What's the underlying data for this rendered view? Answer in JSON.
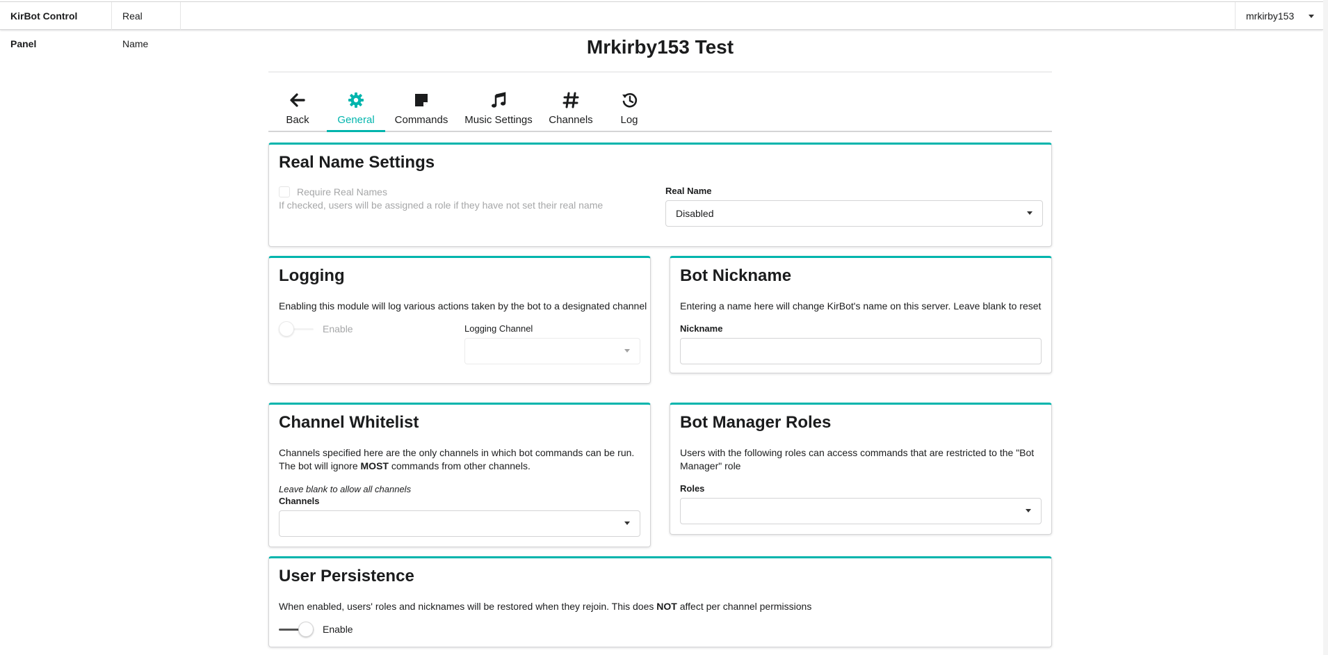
{
  "topbar": {
    "brand": "KirBot Control Panel",
    "section": "Real Name",
    "user": "mrkirby153"
  },
  "page": {
    "title": "Mrkirby153 Test"
  },
  "tabs": [
    {
      "label": "Back",
      "icon": "arrow-left-icon"
    },
    {
      "label": "General",
      "icon": "gear-icon",
      "active": true
    },
    {
      "label": "Commands",
      "icon": "sticky-note-icon"
    },
    {
      "label": "Music Settings",
      "icon": "music-icon"
    },
    {
      "label": "Channels",
      "icon": "hashtag-icon"
    },
    {
      "label": "Log",
      "icon": "history-icon"
    }
  ],
  "realname": {
    "title": "Real Name Settings",
    "checkbox_label": "Require Real Names",
    "checkbox_desc": "If checked, users will be assigned a role if they have not set their real name",
    "select_label": "Real Name",
    "select_value": "Disabled"
  },
  "logging": {
    "title": "Logging",
    "desc": "Enabling this module will log various actions taken by the bot to a designated channel",
    "toggle_label": "Enable",
    "channel_label": "Logging Channel"
  },
  "nickname": {
    "title": "Bot Nickname",
    "desc": "Entering a name here will change KirBot's name on this server. Leave blank to reset",
    "field_label": "Nickname"
  },
  "whitelist": {
    "title": "Channel Whitelist",
    "desc_1": "Channels specified here are the only channels in which bot commands can be run. The bot will ignore ",
    "desc_bold": "MOST",
    "desc_2": " commands from other channels.",
    "hint": "Leave blank to allow all channels",
    "field_label": "Channels"
  },
  "manager": {
    "title": "Bot Manager Roles",
    "desc": "Users with the following roles can access commands that are restricted to the \"Bot Manager\" role",
    "field_label": "Roles"
  },
  "persistence": {
    "title": "User Persistence",
    "desc_1": "When enabled, users' roles and nicknames will be restored when they rejoin. This does ",
    "desc_bold": "NOT",
    "desc_2": " affect per channel permissions",
    "toggle_label": "Enable"
  },
  "colors": {
    "accent": "#00b5ad"
  }
}
